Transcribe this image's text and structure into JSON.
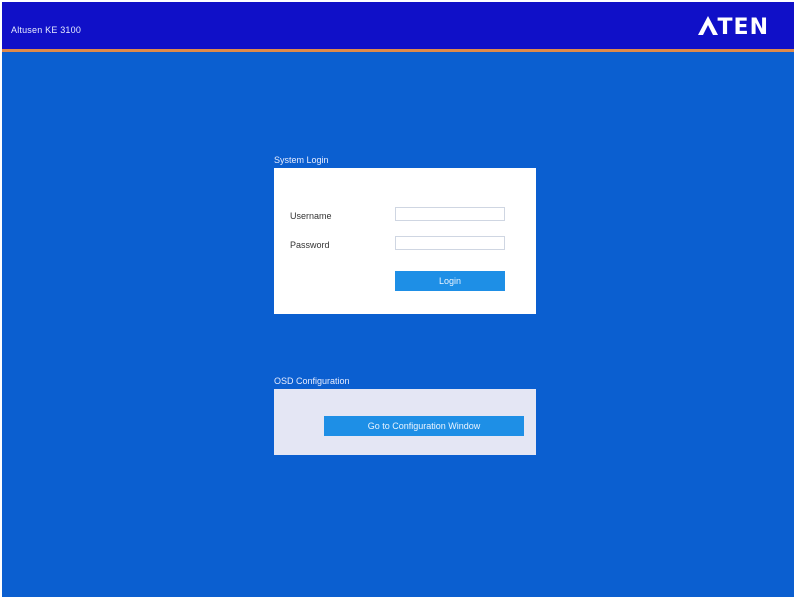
{
  "window": {
    "app_title": "Altusen KE 3100"
  },
  "header": {
    "logo_text": "TEN",
    "logo_icon": "aten-a-logo",
    "logo_alt": "ATEN"
  },
  "login": {
    "section_title": "System Login",
    "username_label": "Username",
    "username_value": "",
    "password_label": "Password",
    "password_value": "",
    "login_button_label": "Login"
  },
  "config": {
    "section_title": "OSD Configuration",
    "button_label": "Go to Configuration Window"
  },
  "colors": {
    "background": "#0b5fd0",
    "header": "#1010c8",
    "header_accent": "#e08a4a",
    "button": "#1e8fe6",
    "panel": "#ffffff",
    "config_panel": "#e4e6f4"
  }
}
